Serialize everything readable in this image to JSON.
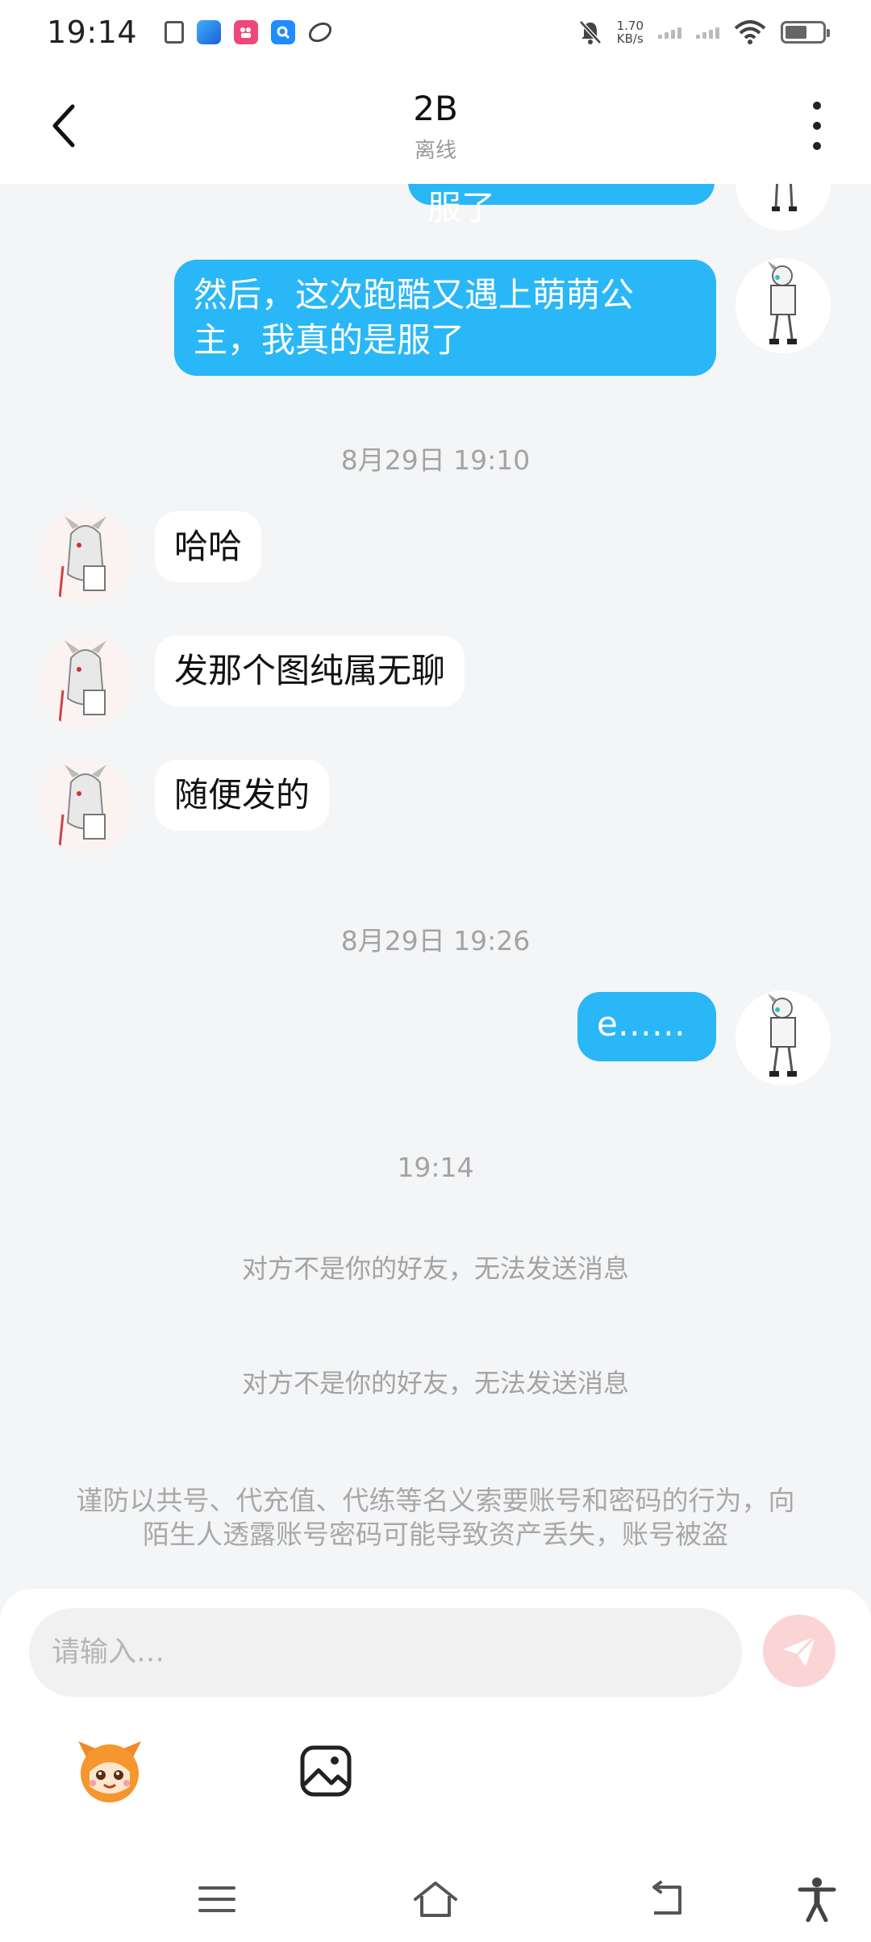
{
  "status_bar": {
    "time": "19:14",
    "net_speed_value": "1.70",
    "net_speed_unit": "KB/s",
    "icons": [
      "doc-notification-icon",
      "game-app-icon",
      "kuaishou-app-icon",
      "search-app-icon",
      "leaf-app-icon",
      "mute-bell-icon",
      "signal-icon",
      "wifi-icon",
      "battery-icon"
    ]
  },
  "header": {
    "title": "2B",
    "subtitle": "离线"
  },
  "messages": {
    "top_partial": "其中有个人我都服了",
    "out1": "然后，这次跑酷又遇上萌萌公主，我真的是服了",
    "ts1": "8月29日 19:10",
    "in1": "哈哈",
    "in2": "发那个图纯属无聊",
    "in3": "随便发的",
    "ts2": "8月29日 19:26",
    "out2": "e……",
    "ts3": "19:14",
    "notice1": "对方不是你的好友，无法发送消息",
    "notice2": "对方不是你的好友，无法发送消息",
    "warning": "谨防以共号、代充值、代练等名义索要账号和密码的行为，向陌生人透露账号密码可能导致资产丢失，账号被盗"
  },
  "input": {
    "placeholder": "请输入…"
  },
  "colors": {
    "outgoing_bubble": "#29b7f7",
    "incoming_bubble": "#ffffff",
    "background": "#f4f5f7",
    "send_button": "#fbd5d5"
  }
}
